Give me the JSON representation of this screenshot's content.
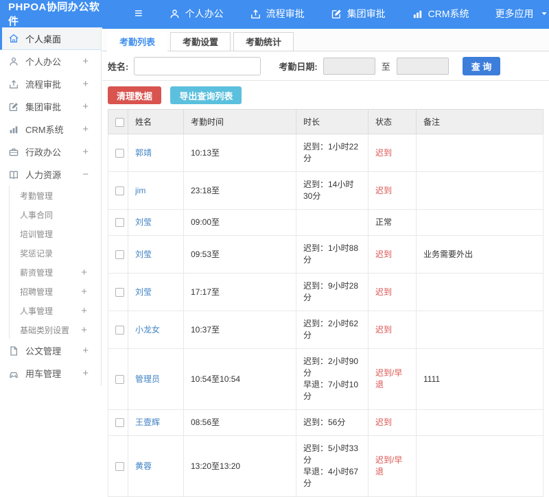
{
  "topbar": {
    "logo": "PHPOA协同办公软件",
    "nav": [
      {
        "label": "个人办公",
        "icon": "user-icon"
      },
      {
        "label": "流程审批",
        "icon": "flow-icon"
      },
      {
        "label": "集团审批",
        "icon": "edit-icon"
      },
      {
        "label": "CRM系统",
        "icon": "chart-icon"
      },
      {
        "label": "更多应用",
        "caret": true
      }
    ]
  },
  "sidebar": {
    "items": [
      {
        "type": "top",
        "label": "个人桌面",
        "icon": "home-icon",
        "suffix": "",
        "active": true
      },
      {
        "type": "top",
        "label": "个人办公",
        "icon": "user-icon",
        "suffix": "+"
      },
      {
        "type": "top",
        "label": "流程审批",
        "icon": "flow-icon",
        "suffix": "+"
      },
      {
        "type": "top",
        "label": "集团审批",
        "icon": "edit-icon",
        "suffix": "+"
      },
      {
        "type": "top",
        "label": "CRM系统",
        "icon": "chart-icon",
        "suffix": "+"
      },
      {
        "type": "top",
        "label": "行政办公",
        "icon": "briefcase-icon",
        "suffix": "+"
      },
      {
        "type": "top",
        "label": "人力资源",
        "icon": "book-icon",
        "suffix": "−"
      },
      {
        "type": "sub",
        "label": "考勤管理",
        "suffix": ""
      },
      {
        "type": "sub",
        "label": "人事合同",
        "suffix": ""
      },
      {
        "type": "sub",
        "label": "培训管理",
        "suffix": ""
      },
      {
        "type": "sub",
        "label": "奖惩记录",
        "suffix": ""
      },
      {
        "type": "sub",
        "label": "薪资管理",
        "suffix": "+"
      },
      {
        "type": "sub",
        "label": "招聘管理",
        "suffix": "+"
      },
      {
        "type": "sub",
        "label": "人事管理",
        "suffix": "+"
      },
      {
        "type": "sub",
        "label": "基础类别设置",
        "suffix": "+"
      },
      {
        "type": "top",
        "label": "公文管理",
        "icon": "doc-icon",
        "suffix": "+"
      },
      {
        "type": "top",
        "label": "用车管理",
        "icon": "car-icon",
        "suffix": "+"
      }
    ]
  },
  "tabs": [
    {
      "label": "考勤列表",
      "active": true
    },
    {
      "label": "考勤设置",
      "active": false
    },
    {
      "label": "考勤统计",
      "active": false
    }
  ],
  "filter": {
    "name_label": "姓名:",
    "name_value": "",
    "date_label": "考勤日期:",
    "date_from": "",
    "to_label": "至",
    "date_to": "",
    "search_button": "查 询"
  },
  "actions": {
    "clean_button": "清理数据",
    "export_button": "导出查询列表"
  },
  "table": {
    "headers": [
      "姓名",
      "考勤时间",
      "时长",
      "状态",
      "备注"
    ],
    "rows": [
      {
        "name": "郭靖",
        "time": "10:13至",
        "duration": "迟到：1小时22分",
        "status": "迟到",
        "status_red": true,
        "note": ""
      },
      {
        "name": "jim",
        "time": "23:18至",
        "duration": "迟到：14小时30分",
        "status": "迟到",
        "status_red": true,
        "note": ""
      },
      {
        "name": "刘莹",
        "time": "09:00至",
        "duration": "",
        "status": "正常",
        "status_red": false,
        "note": ""
      },
      {
        "name": "刘莹",
        "time": "09:53至",
        "duration": "迟到：1小时88分",
        "status": "迟到",
        "status_red": true,
        "note": "业务需要外出"
      },
      {
        "name": "刘莹",
        "time": "17:17至",
        "duration": "迟到：9小时28分",
        "status": "迟到",
        "status_red": true,
        "note": ""
      },
      {
        "name": "小龙女",
        "time": "10:37至",
        "duration": "迟到：2小时62分",
        "status": "迟到",
        "status_red": true,
        "note": ""
      },
      {
        "name": "管理员",
        "time": "10:54至10:54",
        "duration": "迟到：2小时90分\n早退：7小时10分",
        "status": "迟到/早退",
        "status_red": true,
        "note": "1111"
      },
      {
        "name": "王壹辉",
        "time": "08:56至",
        "duration": "迟到：56分",
        "status": "迟到",
        "status_red": true,
        "note": ""
      },
      {
        "name": "黄蓉",
        "time": "13:20至13:20",
        "duration": "迟到：5小时33分\n早退：4小时67分",
        "status": "迟到/早退",
        "status_red": true,
        "note": ""
      }
    ]
  },
  "colors": {
    "topbar_blue": "#3f8ef0",
    "link_blue": "#4183c4",
    "status_red": "#d9534f",
    "danger_button": "#d9534f",
    "info_button": "#5bc0de",
    "search_button": "#3d7edb"
  }
}
